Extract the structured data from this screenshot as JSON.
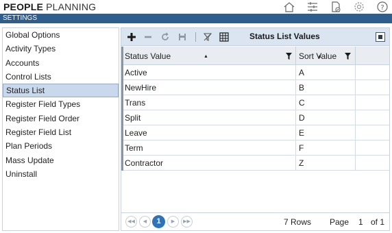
{
  "header": {
    "title_bold": "PEOPLE",
    "title_rest": "PLANNING",
    "icons": [
      "home-icon",
      "sliders-icon",
      "document-check-icon",
      "gear-icon",
      "help-icon"
    ]
  },
  "settings_bar": {
    "label": "SETTINGS"
  },
  "sidebar": {
    "selected": "Status List",
    "items": [
      {
        "label": "Global Options"
      },
      {
        "label": "Activity Types"
      },
      {
        "label": "Accounts"
      },
      {
        "label": "Control Lists"
      },
      {
        "label": "Status List"
      },
      {
        "label": "Register Field Types"
      },
      {
        "label": "Register Field Order"
      },
      {
        "label": "Register Field List"
      },
      {
        "label": "Plan Periods"
      },
      {
        "label": "Mass Update"
      },
      {
        "label": "Uninstall"
      }
    ]
  },
  "panel": {
    "title": "Status List Values",
    "toolbar_icons": [
      "add-icon",
      "remove-icon",
      "refresh-icon",
      "save-icon",
      "filter-clear-icon",
      "grid-settings-icon"
    ],
    "columns": [
      {
        "label": "Status Value"
      },
      {
        "label": "Sort Value"
      },
      {
        "label": ""
      }
    ],
    "rows": [
      {
        "status": "Active",
        "sort": "A"
      },
      {
        "status": "NewHire",
        "sort": "B"
      },
      {
        "status": "Trans",
        "sort": "C"
      },
      {
        "status": "Split",
        "sort": "D"
      },
      {
        "status": "Leave",
        "sort": "E"
      },
      {
        "status": "Term",
        "sort": "F"
      },
      {
        "status": "Contractor",
        "sort": "Z"
      }
    ],
    "pager": {
      "current_page": "1",
      "rows_label": "7 Rows",
      "page_label": "Page",
      "page_value": "1",
      "of_label": "of 1"
    }
  },
  "colors": {
    "accent": "#2f5d8c",
    "toolbar_bg": "#dbe5f1",
    "selected_bg": "#c9d8ea",
    "page_btn": "#2f72b6"
  }
}
